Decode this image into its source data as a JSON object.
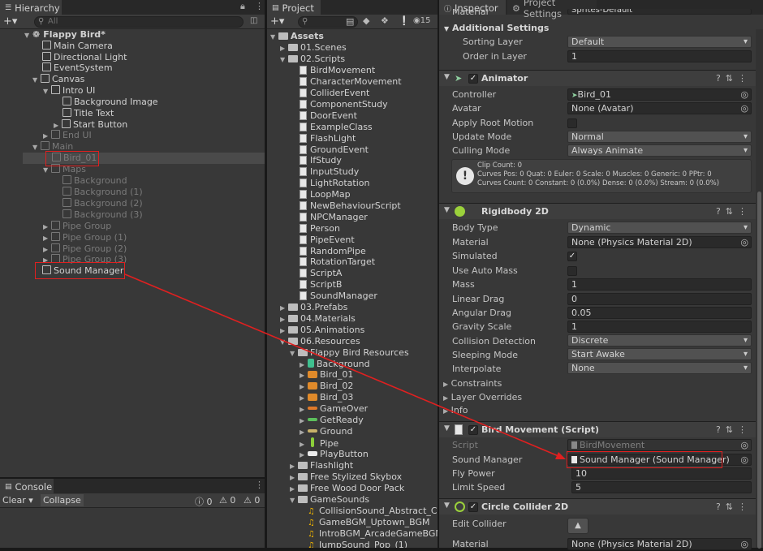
{
  "hierarchy": {
    "tab": "Hierarchy",
    "search_placeholder": "All",
    "scene": "Flappy Bird*",
    "items": [
      {
        "label": "Main Camera"
      },
      {
        "label": "Directional Light"
      },
      {
        "label": "EventSystem"
      },
      {
        "label": "Canvas"
      },
      {
        "label": "Intro UI"
      },
      {
        "label": "Background Image"
      },
      {
        "label": "Title Text"
      },
      {
        "label": "Start Button"
      },
      {
        "label": "End UI"
      },
      {
        "label": "Main"
      },
      {
        "label": "Bird_01"
      },
      {
        "label": "Maps"
      },
      {
        "label": "Background"
      },
      {
        "label": "Background (1)"
      },
      {
        "label": "Background (2)"
      },
      {
        "label": "Background (3)"
      },
      {
        "label": "Pipe Group"
      },
      {
        "label": "Pipe Group (1)"
      },
      {
        "label": "Pipe Group (2)"
      },
      {
        "label": "Pipe Group (3)"
      },
      {
        "label": "Sound Manager"
      }
    ]
  },
  "console": {
    "tab": "Console",
    "clear": "Clear",
    "collapse": "Collapse",
    "count_log": "0",
    "count_warn": "0",
    "count_error": "0"
  },
  "project": {
    "tab": "Project",
    "hidden_count": "15",
    "root": "Assets",
    "items": [
      {
        "label": "01.Scenes"
      },
      {
        "label": "02.Scripts"
      },
      {
        "label": "BirdMovement"
      },
      {
        "label": "CharacterMovement"
      },
      {
        "label": "ColliderEvent"
      },
      {
        "label": "ComponentStudy"
      },
      {
        "label": "DoorEvent"
      },
      {
        "label": "ExampleClass"
      },
      {
        "label": "FlashLight"
      },
      {
        "label": "GroundEvent"
      },
      {
        "label": "IfStudy"
      },
      {
        "label": "InputStudy"
      },
      {
        "label": "LightRotation"
      },
      {
        "label": "LoopMap"
      },
      {
        "label": "NewBehaviourScript"
      },
      {
        "label": "NPCManager"
      },
      {
        "label": "Person"
      },
      {
        "label": "PipeEvent"
      },
      {
        "label": "RandomPipe"
      },
      {
        "label": "RotationTarget"
      },
      {
        "label": "ScriptA"
      },
      {
        "label": "ScriptB"
      },
      {
        "label": "SoundManager"
      },
      {
        "label": "03.Prefabs"
      },
      {
        "label": "04.Materials"
      },
      {
        "label": "05.Animations"
      },
      {
        "label": "06.Resources"
      },
      {
        "label": "Flappy Bird Resources"
      },
      {
        "label": "Background"
      },
      {
        "label": "Bird_01"
      },
      {
        "label": "Bird_02"
      },
      {
        "label": "Bird_03"
      },
      {
        "label": "GameOver"
      },
      {
        "label": "GetReady"
      },
      {
        "label": "Ground"
      },
      {
        "label": "Pipe"
      },
      {
        "label": "PlayButton"
      },
      {
        "label": "Flashlight"
      },
      {
        "label": "Free Stylized Skybox"
      },
      {
        "label": "Free Wood Door Pack"
      },
      {
        "label": "GameSounds"
      },
      {
        "label": "CollisionSound_Abstract_Clic"
      },
      {
        "label": "GameBGM_Uptown_BGM"
      },
      {
        "label": "IntroBGM_ArcadeGameBGM1"
      },
      {
        "label": "JumpSound_Pop_(1)"
      }
    ]
  },
  "inspector": {
    "tab": "Inspector",
    "tab2": "Project Settings",
    "top_partial_label": "Material",
    "top_partial_value": "Sprites-Default",
    "additional_settings": "Additional Settings",
    "sorting_layer_label": "Sorting Layer",
    "sorting_layer_value": "Default",
    "order_label": "Order in Layer",
    "order_value": "1",
    "animator": {
      "title": "Animator",
      "controller_label": "Controller",
      "controller_value": "Bird_01",
      "avatar_label": "Avatar",
      "avatar_value": "None (Avatar)",
      "root_motion_label": "Apply Root Motion",
      "update_mode_label": "Update Mode",
      "update_mode_value": "Normal",
      "culling_label": "Culling Mode",
      "culling_value": "Always Animate",
      "info_line1": "Clip Count: 0",
      "info_line2": "Curves Pos: 0 Quat: 0 Euler: 0 Scale: 0 Muscles: 0 Generic: 0 PPtr: 0",
      "info_line3": "Curves Count: 0 Constant: 0 (0.0%) Dense: 0 (0.0%) Stream: 0 (0.0%)"
    },
    "rigidbody": {
      "title": "Rigidbody 2D",
      "body_type_label": "Body Type",
      "body_type_value": "Dynamic",
      "material_label": "Material",
      "material_value": "None (Physics Material 2D)",
      "simulated_label": "Simulated",
      "auto_mass_label": "Use Auto Mass",
      "mass_label": "Mass",
      "mass_value": "1",
      "linear_drag_label": "Linear Drag",
      "linear_drag_value": "0",
      "angular_drag_label": "Angular Drag",
      "angular_drag_value": "0.05",
      "gravity_label": "Gravity Scale",
      "gravity_value": "1",
      "collision_label": "Collision Detection",
      "collision_value": "Discrete",
      "sleeping_label": "Sleeping Mode",
      "sleeping_value": "Start Awake",
      "interpolate_label": "Interpolate",
      "interpolate_value": "None",
      "constraints_label": "Constraints",
      "layer_overrides_label": "Layer Overrides",
      "info_label": "Info"
    },
    "bird_movement": {
      "title": "Bird Movement (Script)",
      "script_label": "Script",
      "script_value": "BirdMovement",
      "sound_manager_label": "Sound Manager",
      "sound_manager_value": "Sound Manager (Sound Manager)",
      "fly_power_label": "Fly Power",
      "fly_power_value": "10",
      "limit_speed_label": "Limit Speed",
      "limit_speed_value": "5"
    },
    "circle_collider": {
      "title": "Circle Collider 2D",
      "edit_collider_label": "Edit Collider",
      "material_label": "Material",
      "material_value": "None (Physics Material 2D)"
    }
  },
  "colors": {
    "annotation_red": "#e02020"
  }
}
